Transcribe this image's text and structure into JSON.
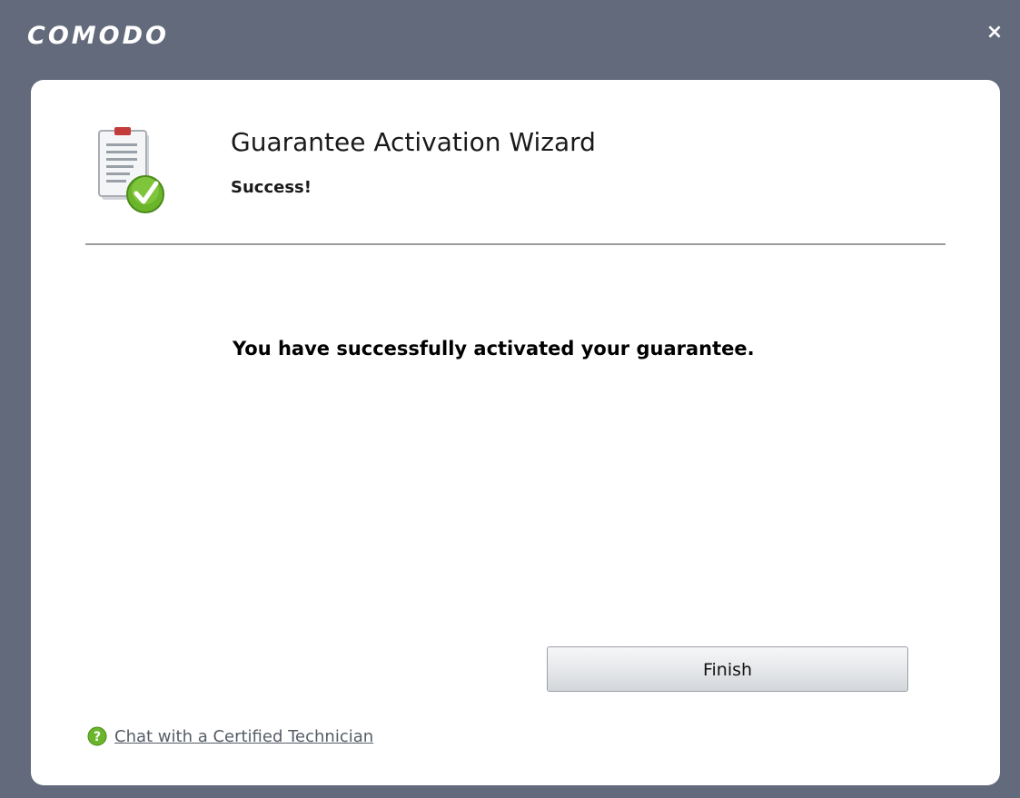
{
  "window": {
    "brand": "COMODO",
    "close_glyph": "×"
  },
  "header": {
    "icon": "clipboard-check-icon",
    "title": "Guarantee Activation Wizard",
    "subtitle": "Success!"
  },
  "content": {
    "message": "You have successfully activated your guarantee."
  },
  "buttons": {
    "finish_label": "Finish"
  },
  "footer": {
    "help_icon": "help-icon",
    "chat_link": "Chat with a Certified Technician"
  },
  "colors": {
    "frame": "#626a7c",
    "panel": "#ffffff",
    "accent_green": "#6bb52b"
  }
}
